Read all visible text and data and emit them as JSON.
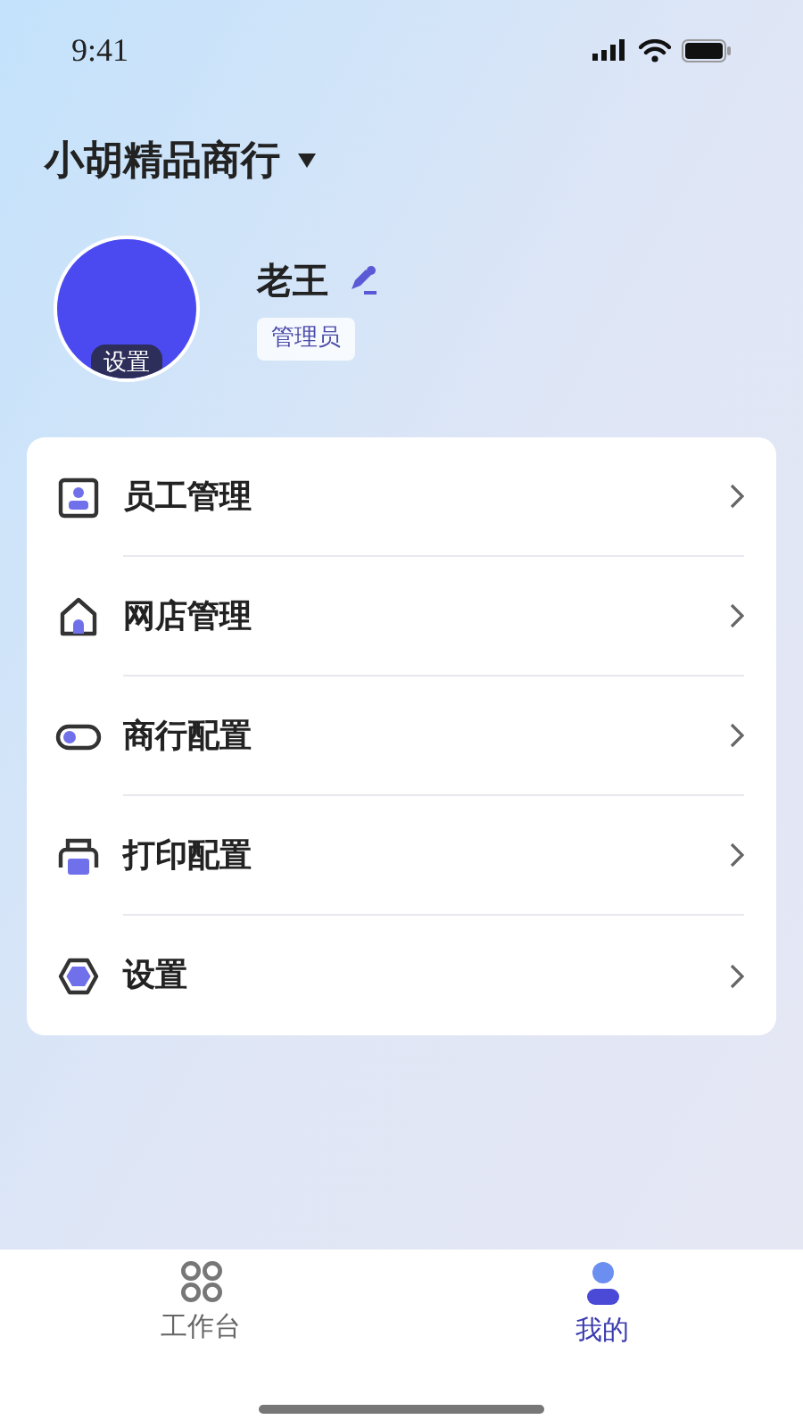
{
  "status_bar": {
    "time": "9:41"
  },
  "shop": {
    "name": "小胡精品商行"
  },
  "profile": {
    "avatar_badge": "设置",
    "name": "老王",
    "role": "管理员"
  },
  "menu": [
    {
      "kind": "person",
      "label": "员工管理"
    },
    {
      "kind": "house",
      "label": "网店管理"
    },
    {
      "kind": "toggle",
      "label": "商行配置"
    },
    {
      "kind": "printer",
      "label": "打印配置"
    },
    {
      "kind": "hexagon",
      "label": "设置"
    }
  ],
  "tabs": [
    {
      "kind": "grid",
      "label": "工作台",
      "selected": false
    },
    {
      "kind": "person",
      "label": "我的",
      "selected": true
    }
  ]
}
